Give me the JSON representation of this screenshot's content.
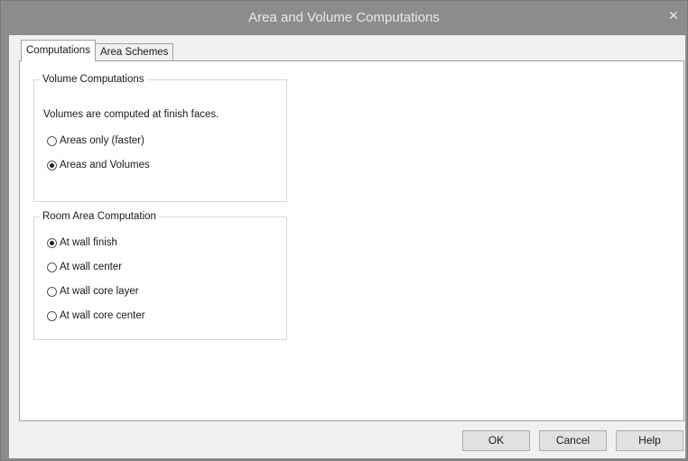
{
  "window": {
    "title": "Area and Volume Computations",
    "close_glyph": "✕"
  },
  "tabs": [
    {
      "label": "Computations",
      "selected": true
    },
    {
      "label": "Area Schemes",
      "selected": false
    }
  ],
  "volume_group": {
    "title": "Volume Computations",
    "note": "Volumes are computed at finish faces.",
    "options": [
      {
        "label": "Areas only (faster)",
        "checked": false
      },
      {
        "label": "Areas and Volumes",
        "checked": true
      }
    ]
  },
  "room_area_group": {
    "title": "Room Area Computation",
    "options": [
      {
        "label": "At wall finish",
        "checked": true
      },
      {
        "label": "At wall center",
        "checked": false
      },
      {
        "label": "At wall core layer",
        "checked": false
      },
      {
        "label": "At wall core center",
        "checked": false
      }
    ]
  },
  "buttons": {
    "ok": "OK",
    "cancel": "Cancel",
    "help": "Help"
  }
}
